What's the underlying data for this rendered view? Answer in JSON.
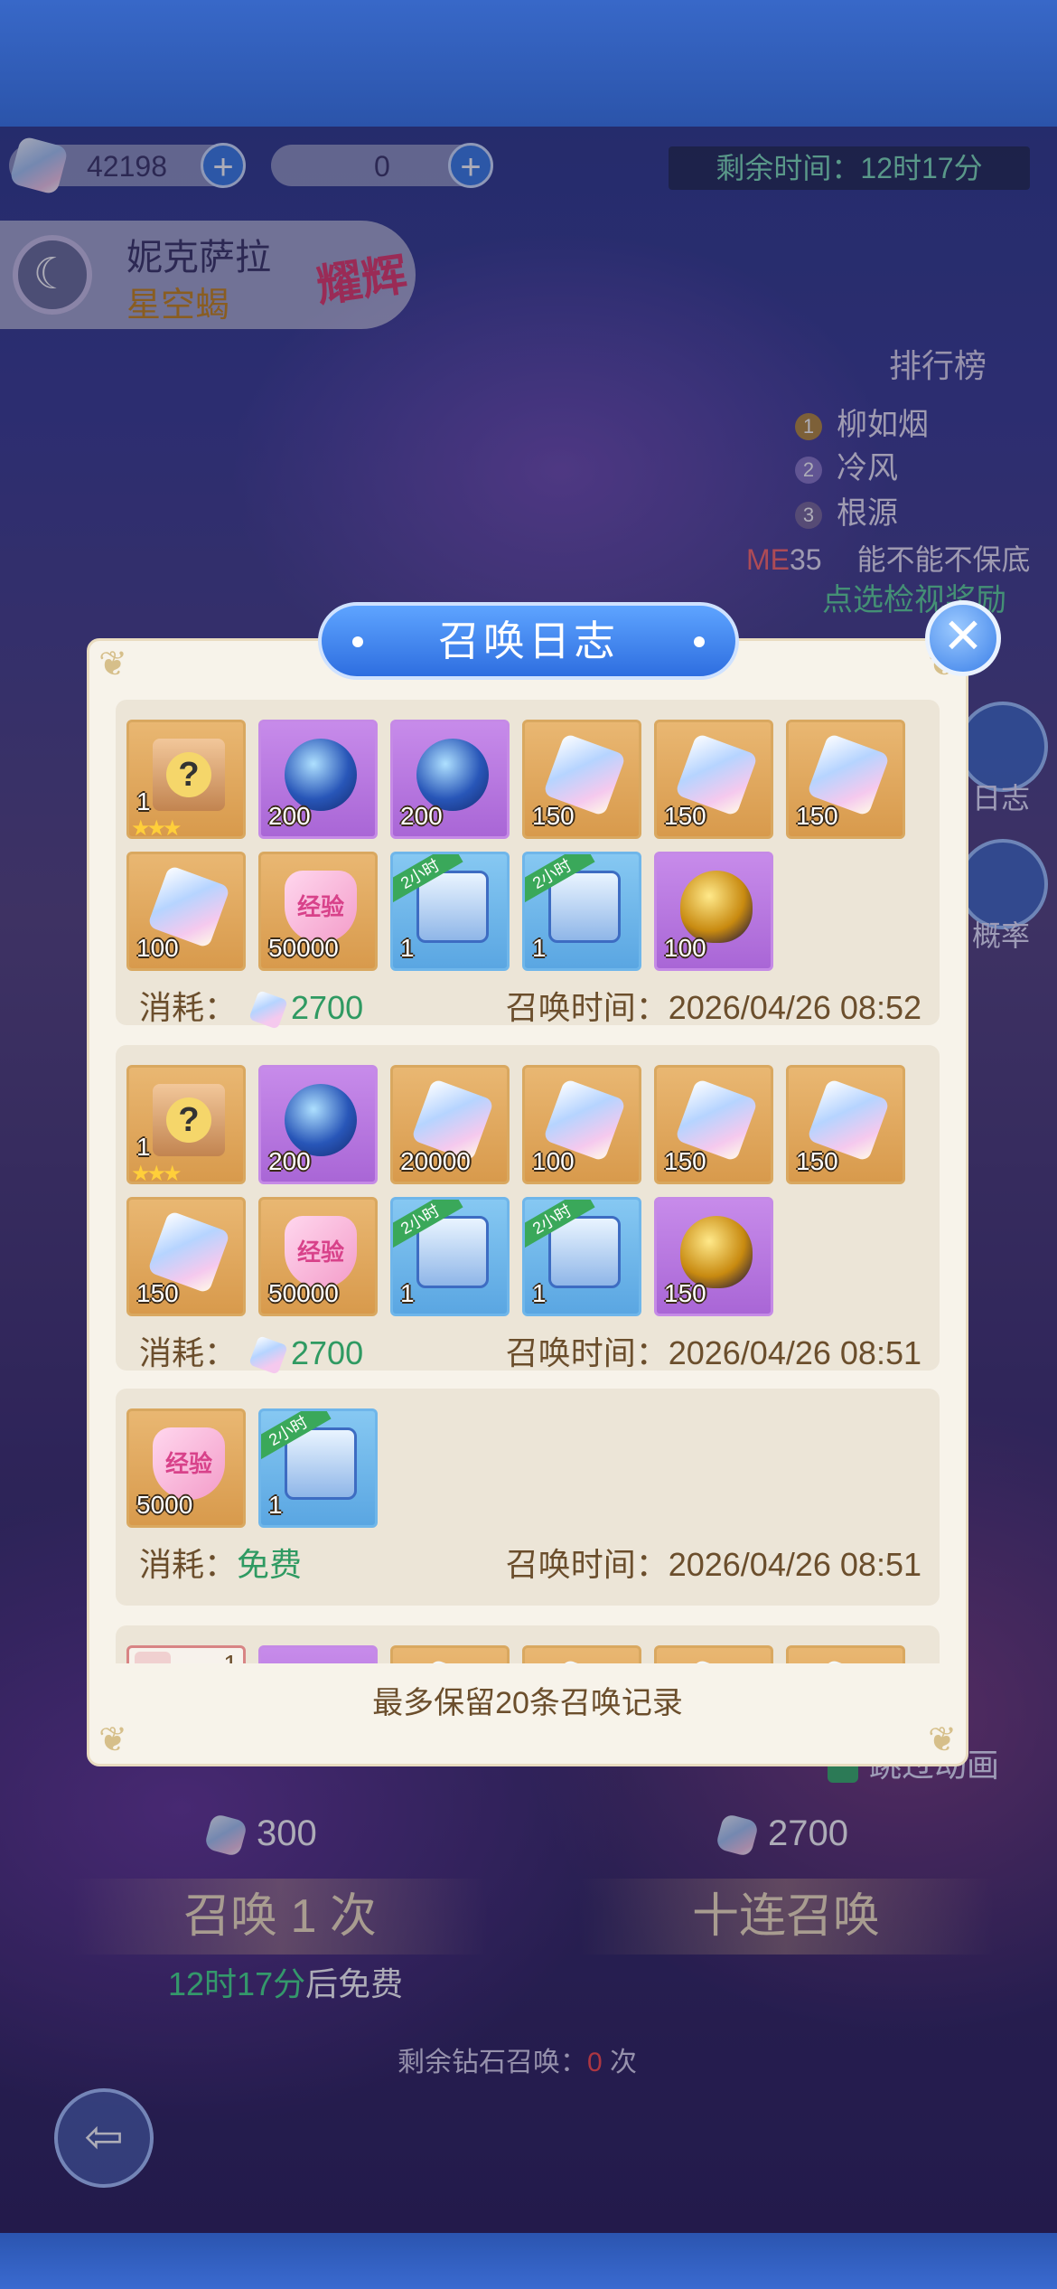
{
  "header": {
    "diamond_count": "42198",
    "token_count": "0",
    "remaining_time": "剩余时间：12时17分"
  },
  "hero": {
    "name": "妮克萨拉",
    "subtitle": "星空蝎",
    "badge": "耀辉"
  },
  "ranking": {
    "title": "排行榜",
    "entries": [
      {
        "rank": "1",
        "name": "柳如烟"
      },
      {
        "rank": "2",
        "name": "冷风"
      },
      {
        "rank": "3",
        "name": "根源"
      }
    ],
    "me_label": "ME",
    "me_rank": "35",
    "me_text": "能不能不保底",
    "link_text": "点选检视奖励"
  },
  "side_buttons": {
    "log_label": "日志",
    "prob_label": "概率"
  },
  "summon": {
    "single_cost": "300",
    "ten_cost": "2700",
    "single_label": "召唤 1 次",
    "ten_label": "十连召唤",
    "free_timer": "12时17分",
    "free_suffix": "后免费",
    "remain_prefix": "剩余钻石召唤：",
    "remain_count": "0",
    "remain_suffix": "次",
    "anim_label": "跳过动画"
  },
  "modal": {
    "title": "召唤日志",
    "close_icon": "close-icon",
    "footer": "最多保留20条召唤记录",
    "cost_label": "消耗：",
    "time_label": "召唤时间：",
    "records": [
      {
        "cost": "2700",
        "time": "2026/04/26 08:52",
        "items": [
          {
            "kind": "box",
            "count": "1",
            "stars": "★★★",
            "icon": "mystery-box-icon"
          },
          {
            "kind": "orb",
            "count": "200",
            "icon": "star-orb-icon"
          },
          {
            "kind": "orb",
            "count": "200",
            "icon": "star-orb-icon"
          },
          {
            "kind": "gem",
            "count": "150",
            "icon": "crystal-icon"
          },
          {
            "kind": "gem",
            "count": "150",
            "icon": "crystal-icon"
          },
          {
            "kind": "gem",
            "count": "150",
            "icon": "crystal-icon"
          },
          {
            "kind": "gem",
            "count": "100",
            "icon": "crystal-icon"
          },
          {
            "kind": "heart",
            "count": "50000",
            "label": "经验",
            "icon": "exp-heart-icon"
          },
          {
            "kind": "chest",
            "count": "1",
            "tag": "2小时",
            "icon": "chest-icon"
          },
          {
            "kind": "chest",
            "count": "1",
            "tag": "2小时",
            "icon": "chest-icon"
          },
          {
            "kind": "egg",
            "count": "100",
            "icon": "golden-egg-icon"
          }
        ]
      },
      {
        "cost": "2700",
        "time": "2026/04/26 08:51",
        "items": [
          {
            "kind": "box",
            "count": "1",
            "stars": "★★★",
            "icon": "mystery-box-icon"
          },
          {
            "kind": "orb",
            "count": "200",
            "icon": "star-orb-icon"
          },
          {
            "kind": "gem",
            "count": "20000",
            "icon": "crystal-icon"
          },
          {
            "kind": "gem",
            "count": "100",
            "icon": "crystal-icon"
          },
          {
            "kind": "gem",
            "count": "150",
            "icon": "crystal-icon"
          },
          {
            "kind": "gem",
            "count": "150",
            "icon": "crystal-icon"
          },
          {
            "kind": "gem",
            "count": "150",
            "icon": "crystal-icon"
          },
          {
            "kind": "heart",
            "count": "50000",
            "label": "经验",
            "icon": "exp-heart-icon"
          },
          {
            "kind": "chest",
            "count": "1",
            "tag": "2小时",
            "icon": "chest-icon"
          },
          {
            "kind": "chest",
            "count": "1",
            "tag": "2小时",
            "icon": "chest-icon"
          },
          {
            "kind": "egg",
            "count": "150",
            "icon": "golden-egg-icon"
          }
        ]
      },
      {
        "cost": "免费",
        "cost_is_text": true,
        "time": "2026/04/26 08:51",
        "items": [
          {
            "kind": "heart",
            "count": "5000",
            "label": "经验",
            "icon": "exp-heart-icon"
          },
          {
            "kind": "chest",
            "count": "1",
            "tag": "2小时",
            "icon": "chest-icon"
          }
        ]
      },
      {
        "partial": true,
        "items": [
          {
            "kind": "card",
            "count": "1",
            "icon": "character-card-icon"
          },
          {
            "kind": "orb",
            "count": "",
            "icon": "star-orb-icon"
          },
          {
            "kind": "gem",
            "count": "",
            "icon": "crystal-icon"
          },
          {
            "kind": "gem",
            "count": "",
            "icon": "crystal-icon"
          },
          {
            "kind": "gem",
            "count": "",
            "icon": "crystal-icon"
          },
          {
            "kind": "gem",
            "count": "",
            "icon": "crystal-icon"
          }
        ]
      }
    ]
  },
  "colors": {
    "accent_blue": "#3a7de6",
    "modal_bg": "#f7f3ea",
    "cost_green": "#2f9a62",
    "text_brown": "#6b4e2c",
    "timer_green": "#7fe0b8"
  }
}
